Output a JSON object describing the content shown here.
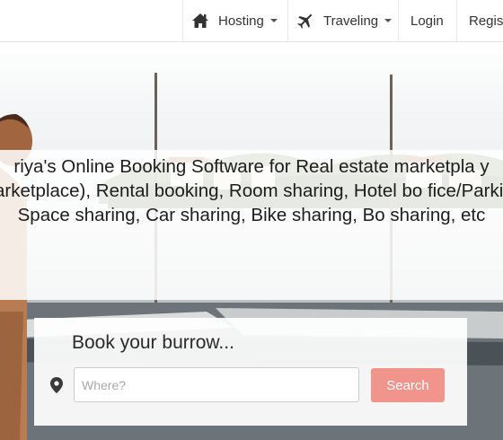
{
  "nav": {
    "hosting": {
      "icon": "home-icon",
      "label": "Hosting"
    },
    "traveling": {
      "icon": "airplane-icon",
      "label": "Traveling"
    },
    "login": "Login",
    "register": "Regist"
  },
  "hero": {
    "headline": "riya's Online Booking Software for Real estate marketpla y marketplace), Rental booking, Room sharing, Hotel bo fice/Parking Space sharing, Car sharing, Bike sharing, Bo sharing, etc"
  },
  "booking": {
    "title": "Book your burrow...",
    "location_icon": "map-pin-icon",
    "where_placeholder": "Where?",
    "where_value": "",
    "search_label": "Search"
  },
  "colors": {
    "accent": "#f0948c",
    "nav_text": "#333333"
  }
}
